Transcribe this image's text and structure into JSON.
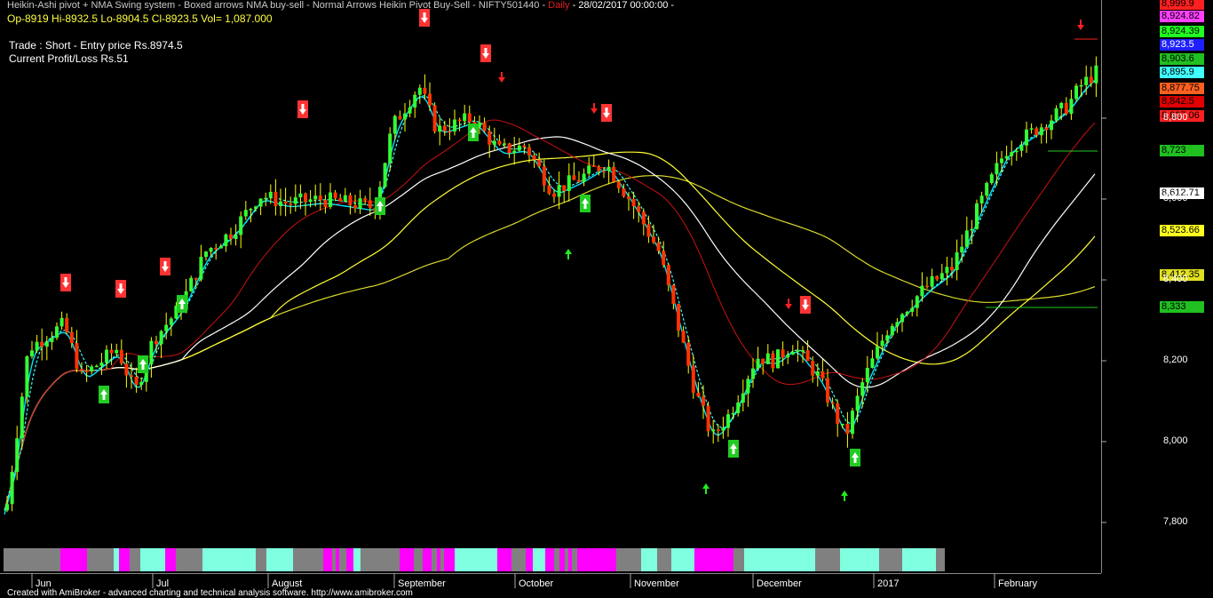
{
  "header": {
    "title": "Heikin-Ashi pivot + NMA Swing system - Boxed arrows NMA buy-sell - Normal Arrows Heikin Pivot Buy-Sell - NIFTY501440 - ",
    "interval": "Daily",
    "date": " - 28/02/2017 00:00:00 - ",
    "ohlc": "Op-8919  Hi-8932.5  Lo-8904.5  Cl-8923.5  Vol= 1,087.000"
  },
  "trade": {
    "line1": "Trade : Short - Entry price Rs.8974.5",
    "line2": "Current Profit/Loss Rs.51"
  },
  "footer": "Created with AmiBroker - advanced charting and technical analysis software. http://www.amibroker.com",
  "colors": {
    "background": "#000000",
    "bull_candle": "#33ff33",
    "bear_candle": "#ff3300",
    "wick": "#ffff00",
    "sell_box": "#ff3333",
    "buy_box": "#22cc22",
    "ma_white": "#ffffff",
    "ma_yellow": "#ffff33",
    "ma_red": "#cc1111",
    "cyan_dashed": "#33ffff",
    "band_aqua": "#80ffe0",
    "band_magenta": "#ff00ff",
    "band_gray": "#808080"
  },
  "price_tags": [
    {
      "label": "8,999.9",
      "bg": "#ff2020",
      "fg": "#000000"
    },
    {
      "label": "8,924.82",
      "bg": "#ff40ff",
      "fg": "#000000"
    },
    {
      "label": "8,924.39",
      "bg": "#20ff20",
      "fg": "#000000"
    },
    {
      "label": "8,923.5",
      "bg": "#2020ff",
      "fg": "#ffffff"
    },
    {
      "label": "8,903.6",
      "bg": "#20c020",
      "fg": "#000000"
    },
    {
      "label": "8,895.9",
      "bg": "#40ffff",
      "fg": "#000000"
    },
    {
      "label": "8,877.75",
      "bg": "#ff6020",
      "fg": "#000000"
    },
    {
      "label": "8,842.5",
      "bg": "#e00000",
      "fg": "#000000"
    },
    {
      "label": "8,827.06",
      "bg": "#ff2020",
      "fg": "#000000"
    },
    {
      "label": "8,723",
      "bg": "#20c020",
      "fg": "#000000"
    },
    {
      "label": "8,612.71",
      "bg": "#ffffff",
      "fg": "#000000"
    },
    {
      "label": "8,523.66",
      "bg": "#ffff20",
      "fg": "#000000"
    },
    {
      "label": "8,412.35",
      "bg": "#e0e020",
      "fg": "#000000"
    },
    {
      "label": "8,333",
      "bg": "#20c020",
      "fg": "#000000"
    }
  ],
  "chart_data": {
    "type": "candlestick",
    "ylim": [
      7730,
      9050
    ],
    "y_ticks": [
      "7,800",
      "8,000",
      "8,200",
      "8,400",
      "8,600",
      "8,800"
    ],
    "month_labels": [
      "Jun",
      "Jul",
      "August",
      "September",
      "October",
      "November",
      "December",
      "2017",
      "February"
    ],
    "sell_signals": [
      "Jun",
      "early Jul",
      "Sep",
      "mid Sep",
      "mid Oct",
      "Dec",
      "end Feb"
    ],
    "buy_signals": [
      "late Jun",
      "early Jul",
      "Aug",
      "Sep",
      "Oct",
      "late Nov",
      "end Dec"
    ],
    "trade_position": "Short",
    "entry_price": 8974.5,
    "last_close": 8923.5
  }
}
